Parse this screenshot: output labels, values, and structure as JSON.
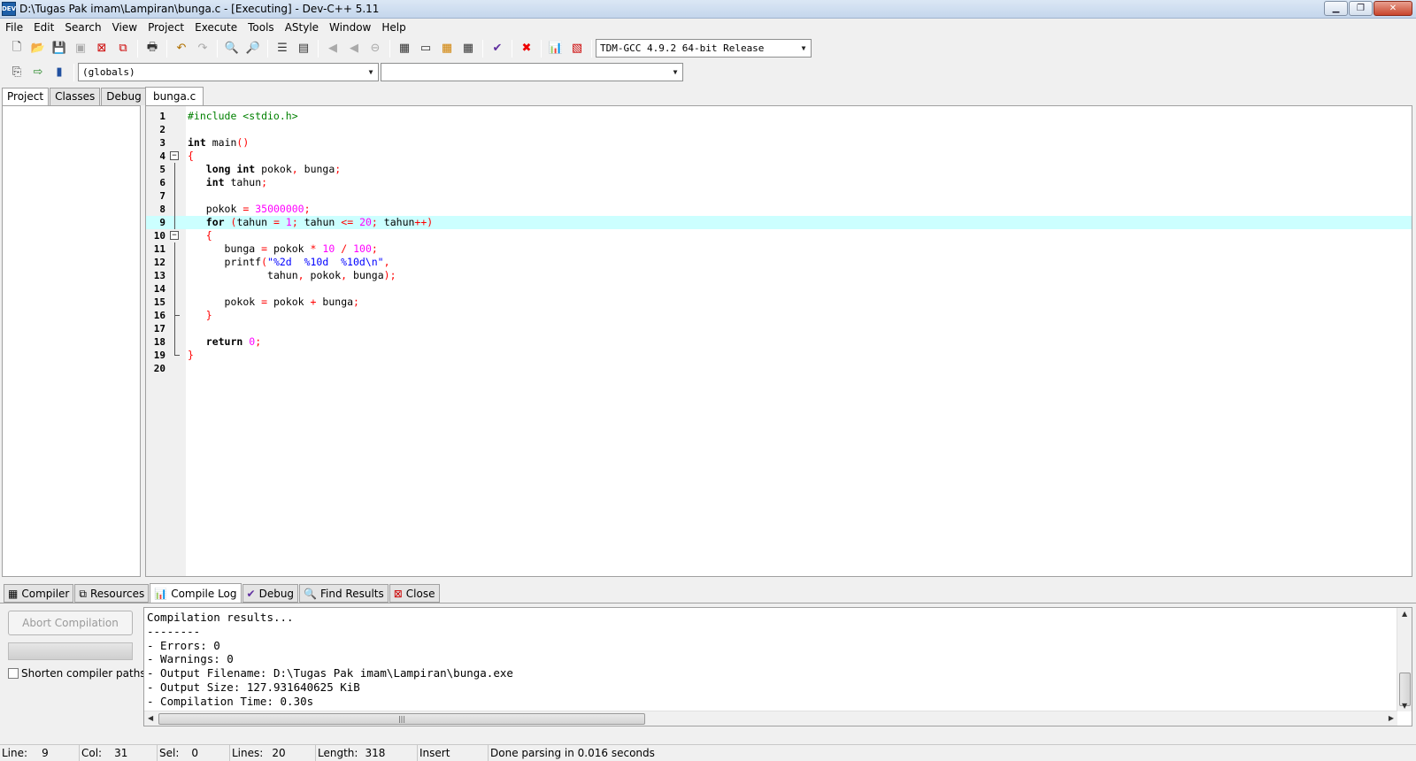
{
  "window": {
    "title": "D:\\Tugas Pak imam\\Lampiran\\bunga.c - [Executing] - Dev-C++ 5.11",
    "icon_text": "DEV"
  },
  "menu": [
    "File",
    "Edit",
    "Search",
    "View",
    "Project",
    "Execute",
    "Tools",
    "AStyle",
    "Window",
    "Help"
  ],
  "toolbar": {
    "compiler_select": "TDM-GCC 4.9.2 64-bit Release",
    "scope_select": "(globals)",
    "member_select": ""
  },
  "left_tabs": [
    "Project",
    "Classes",
    "Debug"
  ],
  "editor": {
    "file_tab": "bunga.c",
    "lines": [
      {
        "n": "1",
        "t": "#include <stdio.h>"
      },
      {
        "n": "2",
        "t": ""
      },
      {
        "n": "3",
        "t": "int main()"
      },
      {
        "n": "4",
        "t": "{"
      },
      {
        "n": "5",
        "t": "   long int pokok, bunga;"
      },
      {
        "n": "6",
        "t": "   int tahun;"
      },
      {
        "n": "7",
        "t": ""
      },
      {
        "n": "8",
        "t": "   pokok = 35000000;"
      },
      {
        "n": "9",
        "t": "   for (tahun = 1; tahun <= 20; tahun++)"
      },
      {
        "n": "10",
        "t": "   {"
      },
      {
        "n": "11",
        "t": "      bunga = pokok * 10 / 100;"
      },
      {
        "n": "12",
        "t": "      printf(\"%2d  %10d  %10d\\n\","
      },
      {
        "n": "13",
        "t": "             tahun, pokok, bunga);"
      },
      {
        "n": "14",
        "t": ""
      },
      {
        "n": "15",
        "t": "      pokok = pokok + bunga;"
      },
      {
        "n": "16",
        "t": "   }"
      },
      {
        "n": "17",
        "t": ""
      },
      {
        "n": "18",
        "t": "   return 0;"
      },
      {
        "n": "19",
        "t": "}"
      },
      {
        "n": "20",
        "t": ""
      }
    ]
  },
  "bottom_tabs": [
    "Compiler",
    "Resources",
    "Compile Log",
    "Debug",
    "Find Results",
    "Close"
  ],
  "compile": {
    "abort_label": "Abort Compilation",
    "shorten_label": "Shorten compiler paths",
    "log": [
      "Compilation results...",
      "--------",
      "- Errors: 0",
      "- Warnings: 0",
      "- Output Filename: D:\\Tugas Pak imam\\Lampiran\\bunga.exe",
      "- Output Size: 127.931640625 KiB",
      "- Compilation Time: 0.30s"
    ]
  },
  "status": {
    "line_label": "Line:",
    "line_val": "9",
    "col_label": "Col:",
    "col_val": "31",
    "sel_label": "Sel:",
    "sel_val": "0",
    "lines_label": "Lines:",
    "lines_val": "20",
    "length_label": "Length:",
    "length_val": "318",
    "mode": "Insert",
    "message": "Done parsing in 0.016 seconds"
  }
}
